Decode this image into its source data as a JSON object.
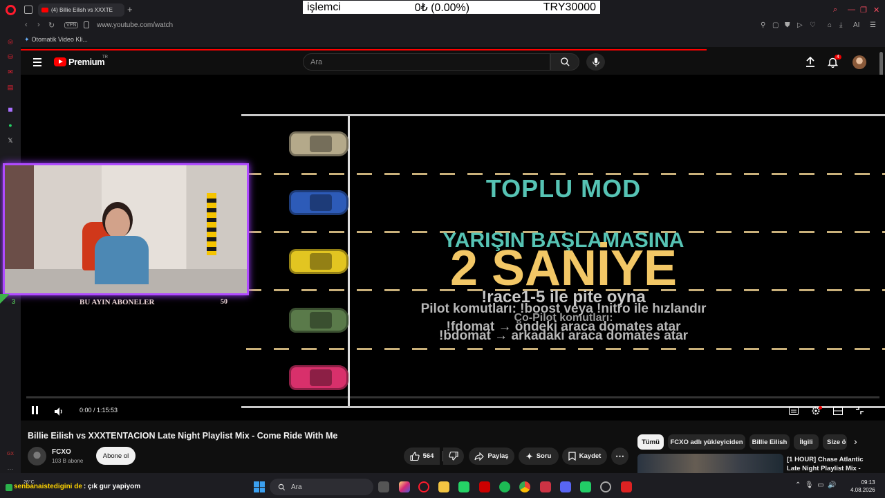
{
  "browser": {
    "tab_title": "(4) Billie Eilish vs XXXTE",
    "url": "www.youtube.com/watch",
    "vpn_label": "VPN",
    "bookmark": "Otomatik Video Kli..."
  },
  "ticker": {
    "label": "işlemci",
    "value": "0₺ (0.00%)",
    "goal": "TRY30000"
  },
  "youtube": {
    "brand": "Premium",
    "region": "TR",
    "search_placeholder": "Ara",
    "notification_count": "4"
  },
  "stream": {
    "mode_title": "TOPLU MOD",
    "countdown_label": "YARIŞIN BAŞLAMASINA",
    "countdown_value": "2 SANİYE",
    "command_main": "!race1-5  ile pite oyna",
    "command_pilot": "Pilot komutları: !boost veya !nitro ile hızlandır",
    "command_copilot": "Co-Pilot komutları:",
    "command_fdomat": "!fdomat → öndeki araca domates atar",
    "command_bdomat": "!bdomat → arkadaki araca domates atar",
    "subs_label": "BU AYIN ABONELER",
    "subs_count": "50",
    "subs_level": "3"
  },
  "player": {
    "time": "0:00 / 1:15:53"
  },
  "video": {
    "title": "Billie Eilish vs XXXTENTACION Late Night Playlist Mix - Come Ride With Me",
    "channel": "FCXO",
    "subscribers": "103 B abone",
    "subscribe_label": "Abone ol",
    "like_count": "564",
    "share_label": "Paylaş",
    "ask_label": "Soru",
    "save_label": "Kaydet"
  },
  "related": {
    "chips": [
      "Tümü",
      "FCXO adlı yükleyiciden",
      "Billie Eilish",
      "İlgili",
      "Size ö"
    ],
    "first_title": "[1 HOUR] Chase Atlantic Late Night Playlist Mix - Come Ride With Me"
  },
  "taskbar": {
    "weather": "26°C",
    "chat_user": "senbanaistedigini de",
    "chat_message": ": çık gur yapiyom",
    "search_label": "Ara",
    "time": "09:13",
    "date": "4.08.2026"
  }
}
